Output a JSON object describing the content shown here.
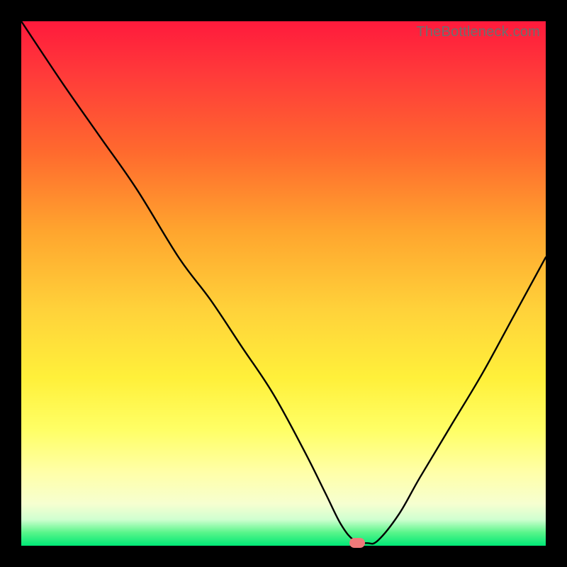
{
  "watermark": "TheBottleneck.com",
  "colors": {
    "frame_bg": "#000000",
    "curve": "#000000",
    "marker": "#f07a7a",
    "gradient_top": "#ff1a3c",
    "gradient_bottom": "#00e876"
  },
  "chart_data": {
    "type": "line",
    "title": "",
    "xlabel": "",
    "ylabel": "",
    "xlim": [
      0,
      100
    ],
    "ylim": [
      0,
      100
    ],
    "grid": false,
    "background": "heatmap-gradient",
    "series": [
      {
        "name": "bottleneck-curve",
        "x": [
          0,
          8,
          15,
          22,
          30,
          36,
          42,
          48,
          54,
          58,
          61,
          63.5,
          66,
          68,
          72,
          76,
          82,
          88,
          94,
          100
        ],
        "values": [
          100,
          88,
          78,
          68,
          55,
          47,
          38,
          29,
          18,
          10,
          4,
          1,
          0.5,
          1,
          6,
          13,
          23,
          33,
          44,
          55
        ]
      }
    ],
    "annotations": [
      {
        "name": "optimum-marker",
        "x": 64,
        "y": 0.5,
        "shape": "pill",
        "color": "#f07a7a"
      }
    ]
  }
}
